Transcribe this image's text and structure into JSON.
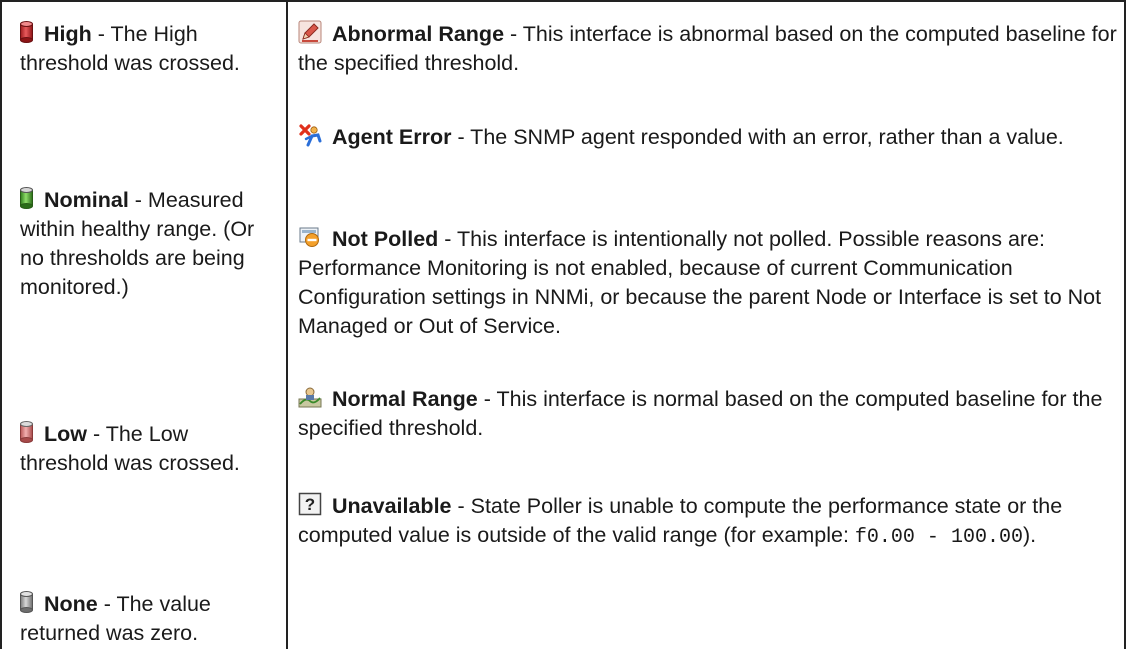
{
  "left": {
    "high": {
      "term": "High",
      "desc": " - The High threshold was crossed."
    },
    "nominal": {
      "term": "Nominal",
      "desc": " - Measured within healthy range. (Or no thresholds are being monitored.)"
    },
    "low": {
      "term": "Low",
      "desc": " - The Low threshold was crossed."
    },
    "none": {
      "term": "None",
      "desc": " - The value returned was zero."
    }
  },
  "right": {
    "abnormal": {
      "term": "Abnormal Range",
      "desc": " - This interface is abnormal based on the computed baseline for the specified threshold."
    },
    "agent_error": {
      "term": "Agent Error",
      "desc": " - The SNMP agent responded with an error, rather than a value."
    },
    "not_polled": {
      "term": "Not Polled",
      "desc": " - This interface is intentionally not polled. Possible reasons are: Performance Monitoring is not enabled, because of current Communication Configuration settings in NNMi, or because the parent Node or Interface is set to Not Managed or Out of Service."
    },
    "normal": {
      "term": "Normal Range",
      "desc": " - This interface is normal based on the computed baseline for the specified threshold."
    },
    "unavailable": {
      "term": "Unavailable",
      "desc": " - State Poller is unable to compute the performance state or the computed value is outside of the valid range (for example: ",
      "code": "f0.00 - 100.00",
      "tail": ")."
    }
  },
  "icons": {
    "high": "red-cylinder-icon",
    "nominal": "green-cylinder-icon",
    "low": "pink-cylinder-icon",
    "none": "gray-cylinder-icon",
    "abnormal": "pencil-icon",
    "agent_error": "agent-error-icon",
    "not_polled": "not-polled-icon",
    "normal": "normal-range-icon",
    "unavailable": "question-icon"
  },
  "colors": {
    "high": "#d9383a",
    "nominal": "#5dbb3a",
    "low": "#e57a7a",
    "none": "#a8a8a8",
    "abnormal": "#c9584a",
    "agent_error": "#e0452a",
    "border": "#222222"
  }
}
